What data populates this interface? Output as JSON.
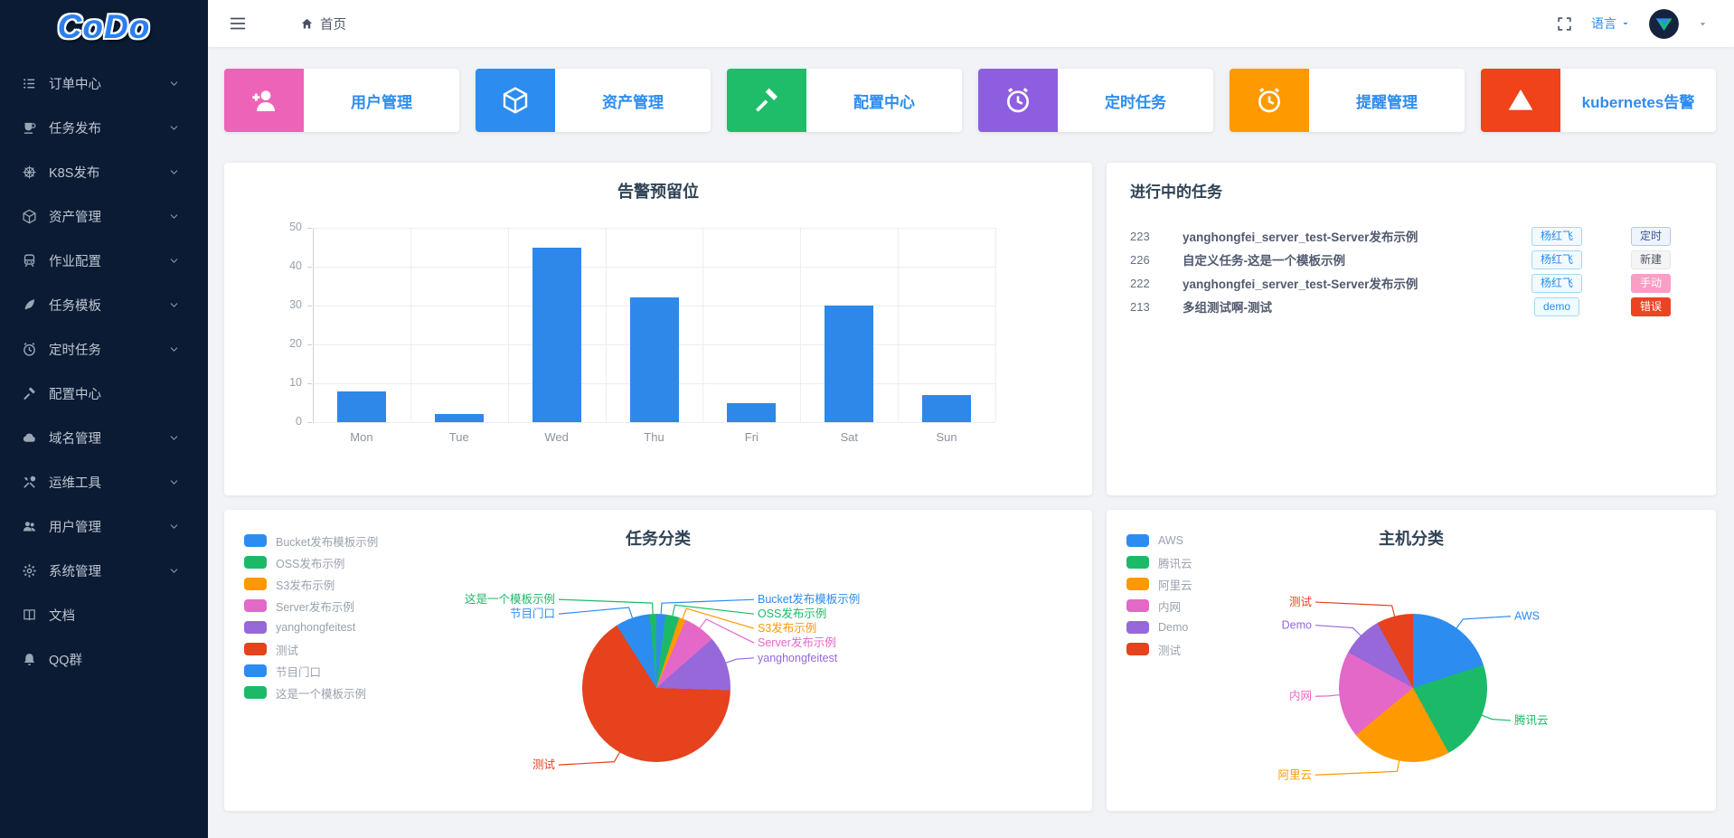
{
  "app": {
    "logo_text": "CoDo"
  },
  "topbar": {
    "breadcrumb_home": "首页",
    "language_label": "语言"
  },
  "sidebar": {
    "items": [
      {
        "key": "order-center",
        "icon": "list",
        "label": "订单中心",
        "chevron": true
      },
      {
        "key": "task-release",
        "icon": "cup",
        "label": "任务发布",
        "chevron": true
      },
      {
        "key": "k8s-release",
        "icon": "helm",
        "label": "K8S发布",
        "chevron": true
      },
      {
        "key": "asset-management",
        "icon": "cube",
        "label": "资产管理",
        "chevron": true
      },
      {
        "key": "job-config",
        "icon": "train",
        "label": "作业配置",
        "chevron": true
      },
      {
        "key": "task-template",
        "icon": "quill",
        "label": "任务模板",
        "chevron": true
      },
      {
        "key": "cron-jobs",
        "icon": "alarm",
        "label": "定时任务",
        "chevron": true
      },
      {
        "key": "config-center",
        "icon": "hammer",
        "label": "配置中心",
        "chevron": false
      },
      {
        "key": "domain-management",
        "icon": "cloud",
        "label": "域名管理",
        "chevron": true
      },
      {
        "key": "ops-tools",
        "icon": "tools",
        "label": "运维工具",
        "chevron": true
      },
      {
        "key": "user-management",
        "icon": "users",
        "label": "用户管理",
        "chevron": true
      },
      {
        "key": "system-management",
        "icon": "gear",
        "label": "系统管理",
        "chevron": true
      },
      {
        "key": "docs",
        "icon": "book",
        "label": "文档",
        "chevron": false
      },
      {
        "key": "qq-group",
        "icon": "bell",
        "label": "QQ群",
        "chevron": false
      }
    ]
  },
  "quick_cards": [
    {
      "key": "user-management",
      "label": "用户管理",
      "icon": "user-plus",
      "color": "#ed63b7"
    },
    {
      "key": "asset-management",
      "label": "资产管理",
      "icon": "cube",
      "color": "#2d8cf0"
    },
    {
      "key": "config-center",
      "label": "配置中心",
      "icon": "hammer",
      "color": "#1fbc69"
    },
    {
      "key": "cron-jobs",
      "label": "定时任务",
      "icon": "alarm",
      "color": "#8d5fe0"
    },
    {
      "key": "reminder-management",
      "label": "提醒管理",
      "icon": "alarm",
      "color": "#ff9900"
    },
    {
      "key": "kubernetes-alerts",
      "label": "kubernetes告警",
      "icon": "warning",
      "color": "#f0431a"
    }
  ],
  "tasks": {
    "title": "进行中的任务",
    "rows": [
      {
        "id": "223",
        "title": "yanghongfei_server_test-Server发布示例",
        "owner": "杨红飞",
        "status": "定时",
        "status_type": "timed"
      },
      {
        "id": "226",
        "title": "自定义任务-这是一个模板示例",
        "owner": "杨红飞",
        "status": "新建",
        "status_type": "new"
      },
      {
        "id": "222",
        "title": "yanghongfei_server_test-Server发布示例",
        "owner": "杨红飞",
        "status": "手动",
        "status_type": "manual"
      },
      {
        "id": "213",
        "title": "多组测试啊-测试",
        "owner": "demo",
        "status": "错误",
        "status_type": "error"
      }
    ]
  },
  "chart_data": [
    {
      "type": "bar",
      "title": "告警预留位",
      "categories": [
        "Mon",
        "Tue",
        "Wed",
        "Thu",
        "Fri",
        "Sat",
        "Sun"
      ],
      "values": [
        8,
        2,
        45,
        32,
        5,
        30,
        7
      ],
      "xlabel": "",
      "ylabel": "",
      "ylim": [
        0,
        50
      ],
      "ytick_step": 10,
      "grid": true,
      "legend": false,
      "bar_color": "#2e88e9"
    },
    {
      "type": "pie",
      "title": "任务分类",
      "legend_position": "top-left",
      "labels": [
        "Bucket发布模板示例",
        "OSS发布示例",
        "S3发布示例",
        "Server发布示例",
        "yanghongfeitest",
        "测试",
        "节目门口",
        "这是一个模板示例"
      ],
      "values": [
        2,
        3,
        1.5,
        7,
        12,
        65.5,
        7.5,
        1.5
      ],
      "colors": [
        "#2d8cf0",
        "#1cba68",
        "#ff9900",
        "#e468c8",
        "#9668d9",
        "#e5421d",
        "#2d8cf0",
        "#1cba68"
      ]
    },
    {
      "type": "pie",
      "title": "主机分类",
      "legend_position": "top-left",
      "labels": [
        "AWS",
        "腾讯云",
        "阿里云",
        "内网",
        "Demo",
        "测试"
      ],
      "values": [
        20,
        22,
        22,
        19,
        9,
        8
      ],
      "colors": [
        "#2d8cf0",
        "#1cba68",
        "#ff9900",
        "#e468c8",
        "#9668d9",
        "#e5421d"
      ]
    }
  ],
  "colors": {
    "accent_blue": "#2d8cf0",
    "sidebar_bg": "#0a1b33",
    "page_bg": "#f1f3f7",
    "title_text": "#2f4356"
  }
}
